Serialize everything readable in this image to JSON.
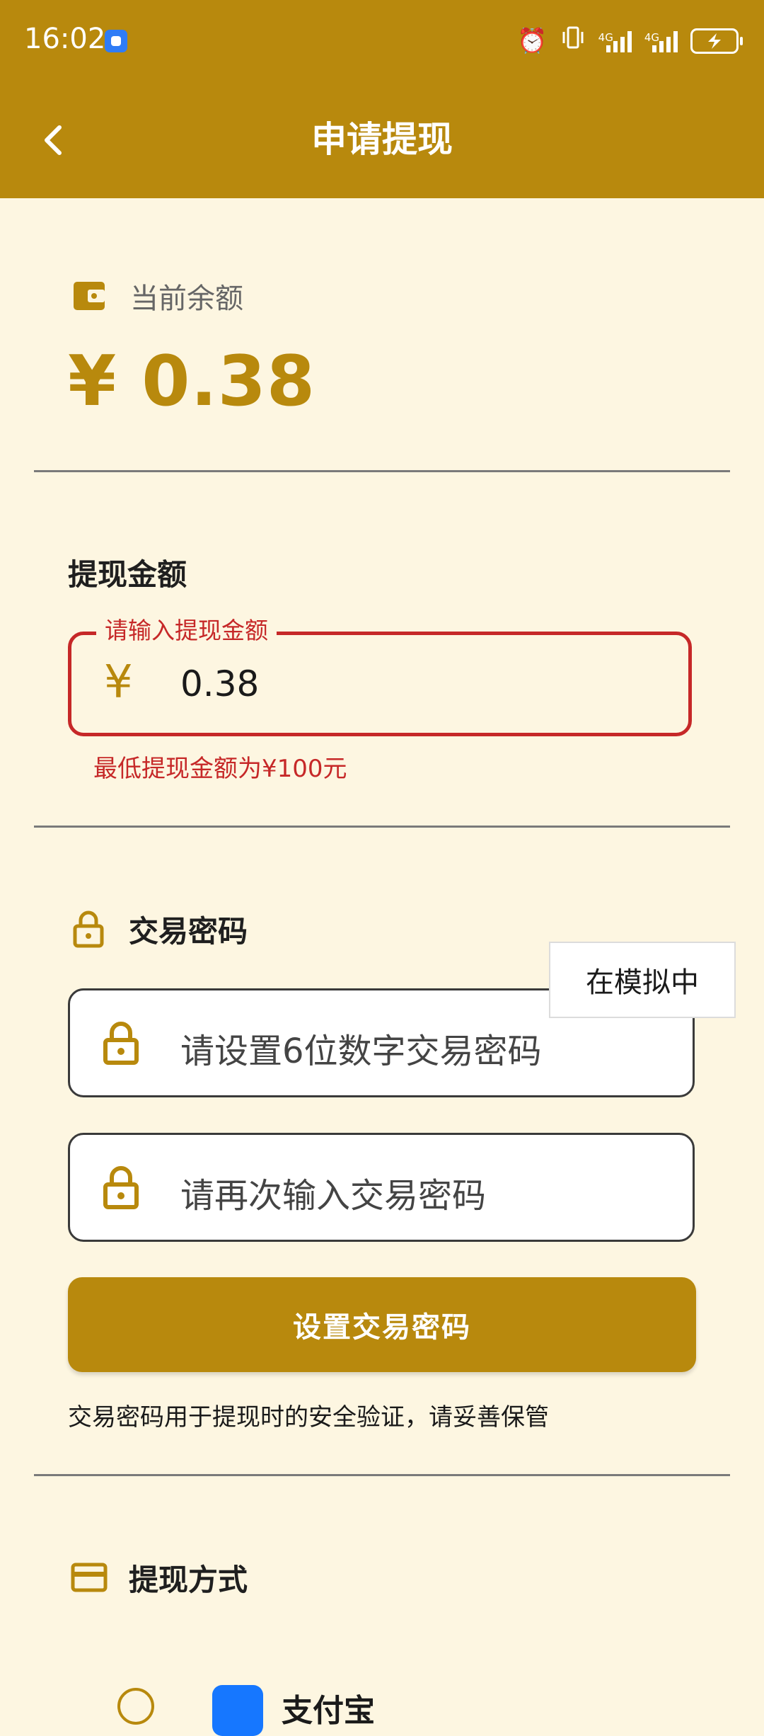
{
  "status_bar": {
    "time": "16:02",
    "network_1": "4G",
    "network_2": "4G"
  },
  "header": {
    "title": "申请提现"
  },
  "balance": {
    "label": "当前余额",
    "amount": "¥ 0.38"
  },
  "amount_section": {
    "title": "提现金额",
    "field_label": "请输入提现金额",
    "currency_symbol": "¥",
    "value": "0.38",
    "error": "最低提现金额为¥100元"
  },
  "password_section": {
    "title": "交易密码",
    "field1_placeholder": "请设置6位数字交易密码",
    "field2_placeholder": "请再次输入交易密码",
    "button": "设置交易密码",
    "help": "交易密码用于提现时的安全验证，请妥善保管"
  },
  "toast": {
    "text": "在模拟中"
  },
  "withdraw_method": {
    "title": "提现方式",
    "option_label": "支付宝"
  },
  "colors": {
    "brand": "#b8890d",
    "background": "#fdf6e1",
    "error": "#c62828"
  }
}
